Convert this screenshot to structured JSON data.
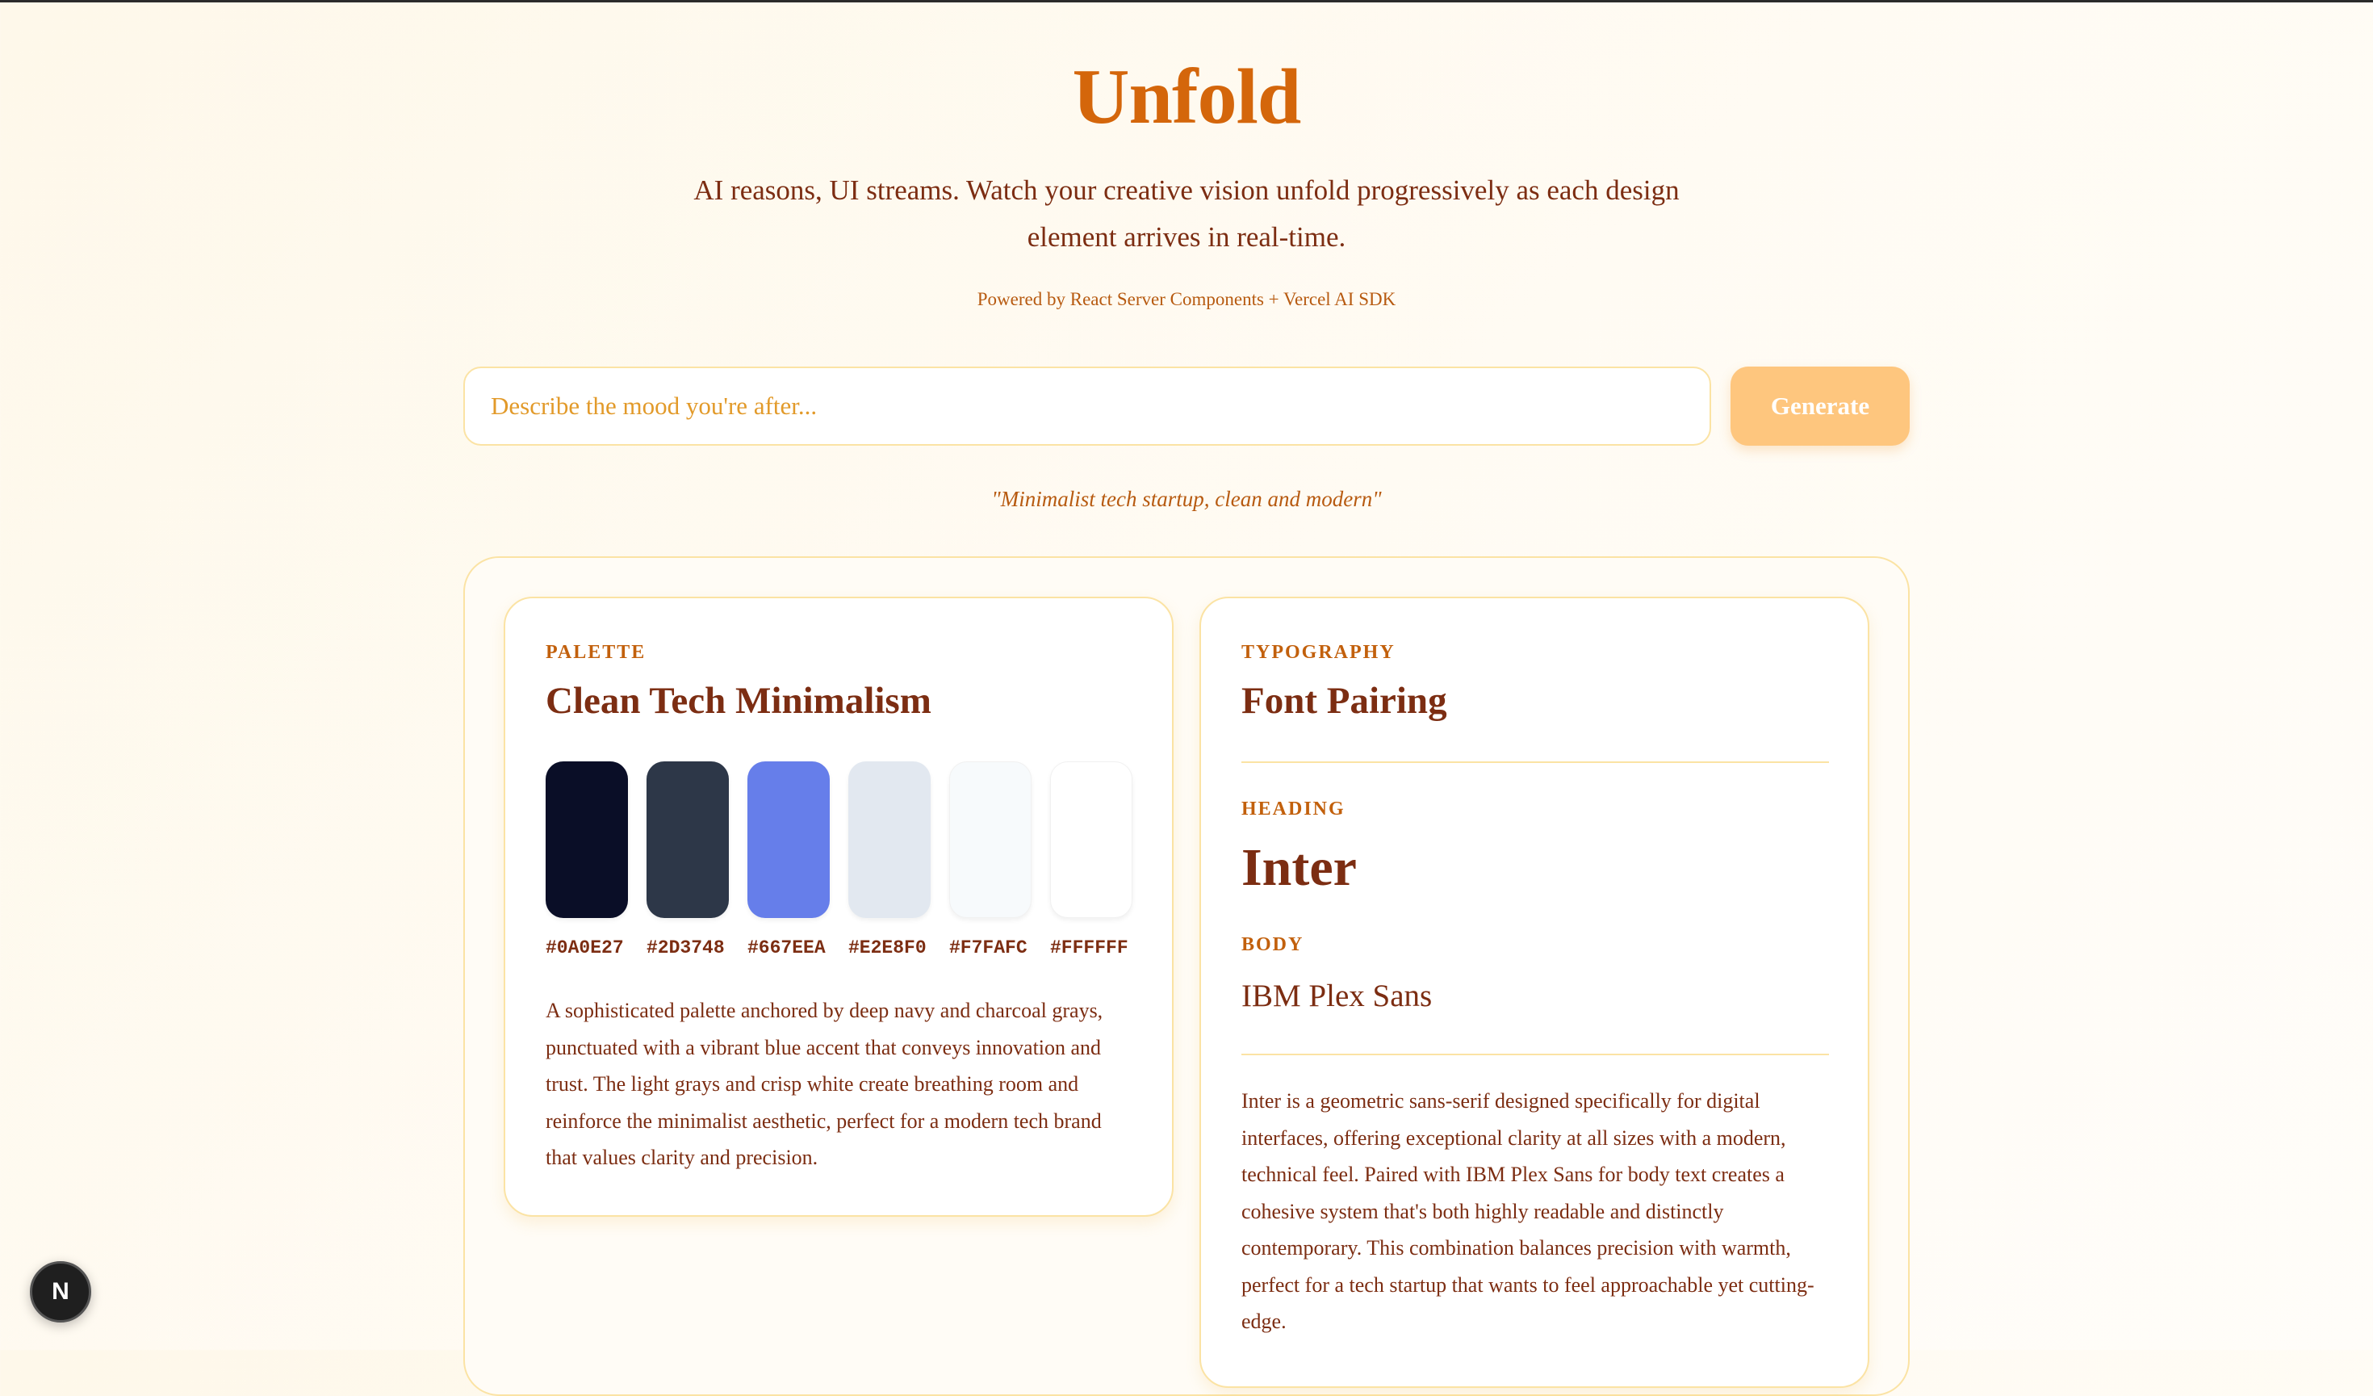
{
  "header": {
    "title": "Unfold",
    "subtitle": "AI reasons, UI streams. Watch your creative vision unfold progressively as each design element arrives in real-time.",
    "powered_by": "Powered by React Server Components + Vercel AI SDK"
  },
  "prompt": {
    "placeholder": "Describe the mood you're after...",
    "value": "",
    "generate_label": "Generate",
    "example": "\"Minimalist tech startup, clean and modern\""
  },
  "palette": {
    "eyebrow": "PALETTE",
    "title": "Clean Tech Minimalism",
    "swatches": [
      {
        "hex": "#0A0E27",
        "color": "#0A0E27"
      },
      {
        "hex": "#2D3748",
        "color": "#2D3748"
      },
      {
        "hex": "#667EEA",
        "color": "#667EEA"
      },
      {
        "hex": "#E2E8F0",
        "color": "#E2E8F0"
      },
      {
        "hex": "#F7FAFC",
        "color": "#F7FAFC"
      },
      {
        "hex": "#FFFFFF",
        "color": "#FFFFFF"
      }
    ],
    "description": "A sophisticated palette anchored by deep navy and charcoal grays, punctuated with a vibrant blue accent that conveys innovation and trust. The light grays and crisp white create breathing room and reinforce the minimalist aesthetic, perfect for a modern tech brand that values clarity and precision."
  },
  "typography": {
    "eyebrow": "TYPOGRAPHY",
    "title": "Font Pairing",
    "heading_label": "HEADING",
    "heading_font": "Inter",
    "body_label": "BODY",
    "body_font": "IBM Plex Sans",
    "description": "Inter is a geometric sans-serif designed specifically for digital interfaces, offering exceptional clarity at all sizes with a modern, technical feel. Paired with IBM Plex Sans for body text creates a cohesive system that's both highly readable and distinctly contemporary. This combination balances precision with warmth, perfect for a tech startup that wants to feel approachable yet cutting-edge."
  },
  "dev_badge": {
    "letter": "N",
    "icon": "nextjs-icon"
  },
  "colors": {
    "accent": "#D4660B",
    "text": "#7C2D12",
    "button": "#FEC67E",
    "border": "#FBE3A4"
  }
}
